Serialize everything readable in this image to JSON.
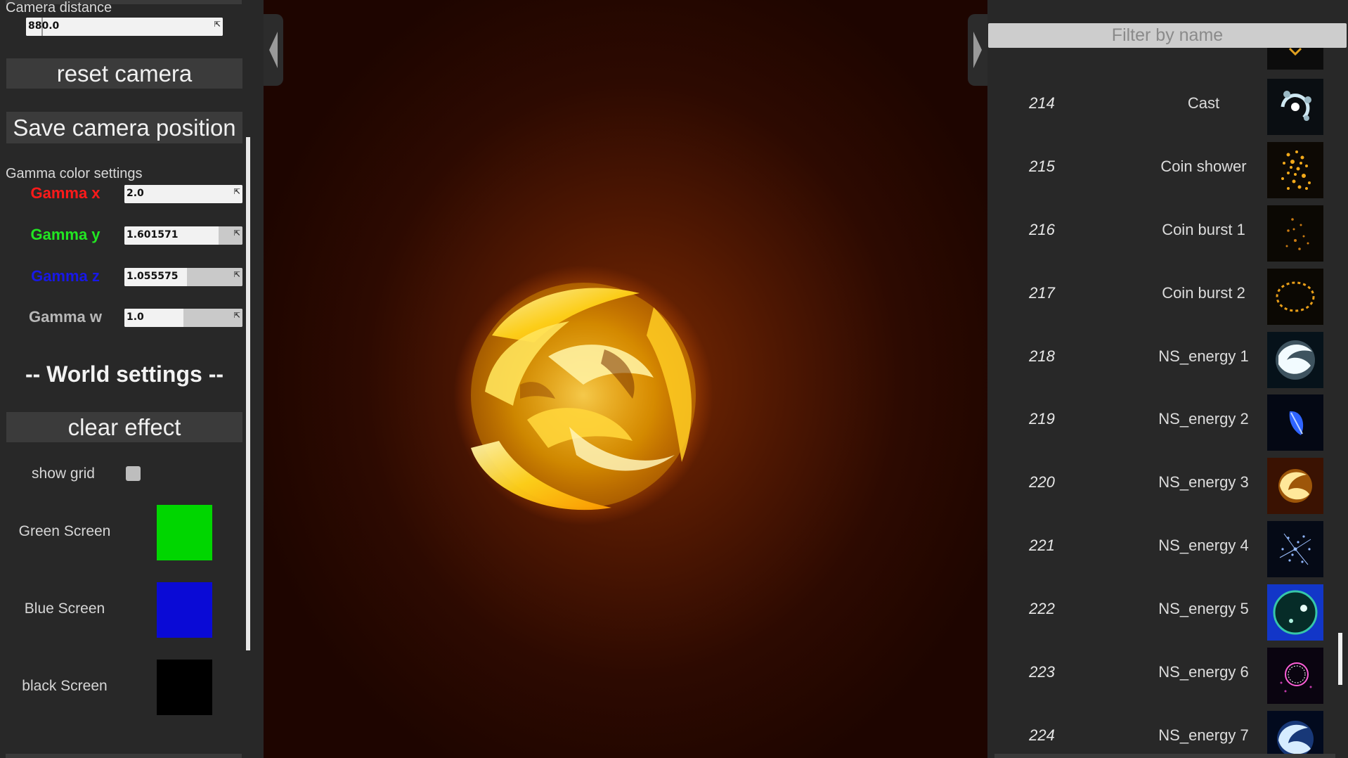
{
  "left_panel": {
    "camera_distance_label": "Camera distance",
    "camera_distance_value": "880.0",
    "camera_distance_fraction": 0.08,
    "reset_camera_label": "reset camera",
    "save_camera_label": "Save camera position",
    "gamma_section_label": "Gamma color settings",
    "gamma": [
      {
        "label": "Gamma x",
        "value": "2.0",
        "fraction": 1.0,
        "color": "#ff1a1a"
      },
      {
        "label": "Gamma y",
        "value": "1.601571",
        "fraction": 0.8,
        "color": "#22e622"
      },
      {
        "label": "Gamma z",
        "value": "1.055575",
        "fraction": 0.53,
        "color": "#1818e6"
      },
      {
        "label": "Gamma w",
        "value": "1.0",
        "fraction": 0.5,
        "color": "#b8b8b8"
      }
    ],
    "world_settings_label": "-- World settings --",
    "clear_effect_label": "clear effect",
    "show_grid_label": "show grid",
    "show_grid_checked": false,
    "screens": [
      {
        "label": "Green Screen",
        "color": "#00d600"
      },
      {
        "label": "Blue Screen",
        "color": "#0a0ad6"
      },
      {
        "label": "black Screen",
        "color": "#000000"
      }
    ]
  },
  "right_panel": {
    "filter_placeholder": "Filter by name",
    "effects": [
      {
        "num": "214",
        "name": "Cast",
        "thumb": "cast-ring"
      },
      {
        "num": "215",
        "name": "Coin shower",
        "thumb": "coin-shower"
      },
      {
        "num": "216",
        "name": "Coin burst 1",
        "thumb": "coin-burst-sparse"
      },
      {
        "num": "217",
        "name": "Coin burst 2",
        "thumb": "coin-ring"
      },
      {
        "num": "218",
        "name": "NS_energy 1",
        "thumb": "white-swirl"
      },
      {
        "num": "219",
        "name": "NS_energy 2",
        "thumb": "blue-leaf"
      },
      {
        "num": "220",
        "name": "NS_energy 3",
        "thumb": "fire-swirl"
      },
      {
        "num": "221",
        "name": "NS_energy 4",
        "thumb": "blue-sparks"
      },
      {
        "num": "222",
        "name": "NS_energy 5",
        "thumb": "teal-orb"
      },
      {
        "num": "223",
        "name": "NS_energy 6",
        "thumb": "pink-ring"
      },
      {
        "num": "224",
        "name": "NS_energy 7",
        "thumb": "blue-swirl"
      }
    ]
  },
  "colors": {
    "panel_bg": "#282828",
    "button_bg": "#3b3b3b",
    "viewport_center": "#7a2a02"
  }
}
